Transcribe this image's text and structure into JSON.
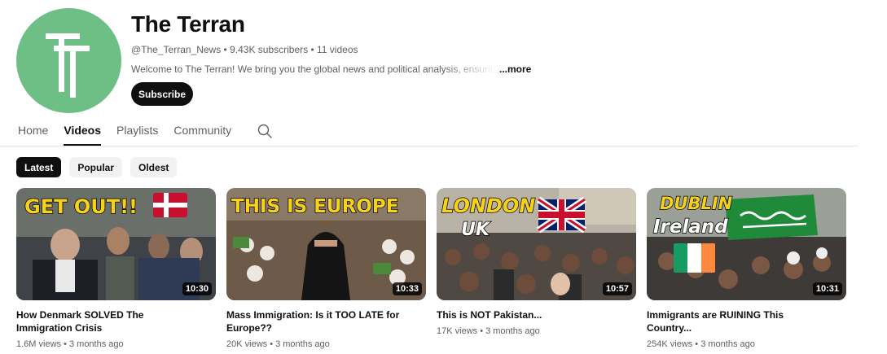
{
  "channel": {
    "avatar_letters": "TT",
    "title": "The Terran",
    "meta": "@The_Terran_News • 9.43K subscribers • 11 videos",
    "description": "Welcome to The Terran! We bring you the global news and political analysis, ensuring you",
    "more_label": "...more",
    "subscribe_label": "Subscribe"
  },
  "tabs": [
    {
      "label": "Home",
      "active": false
    },
    {
      "label": "Videos",
      "active": true
    },
    {
      "label": "Playlists",
      "active": false
    },
    {
      "label": "Community",
      "active": false
    }
  ],
  "search_icon": "search-icon",
  "chips": [
    {
      "label": "Latest",
      "active": true
    },
    {
      "label": "Popular",
      "active": false
    },
    {
      "label": "Oldest",
      "active": false
    }
  ],
  "videos": [
    {
      "title": "How Denmark SOLVED The Immigration Crisis",
      "meta": "1.6M views • 3 months ago",
      "duration": "10:30",
      "thumb_text": [
        "GET OUT!!"
      ],
      "flag": "denmark"
    },
    {
      "title": "Mass Immigration: Is it TOO LATE for Europe??",
      "meta": "20K views • 3 months ago",
      "duration": "10:33",
      "thumb_text": [
        "THIS IS EUROPE"
      ],
      "flag": "none"
    },
    {
      "title": "This is NOT Pakistan...",
      "meta": "17K views • 3 months ago",
      "duration": "10:57",
      "thumb_text": [
        "LONDON",
        "UK"
      ],
      "flag": "uk"
    },
    {
      "title": "Immigrants are RUINING This Country...",
      "meta": "254K views • 3 months ago",
      "duration": "10:31",
      "thumb_text": [
        "DUBLIN",
        "Ireland"
      ],
      "flag": "ireland"
    }
  ],
  "colors": {
    "avatar_bg": "#6dbf86",
    "primary_text": "#0f0f0f",
    "secondary_text": "#606060",
    "chip_bg": "#f2f2f2",
    "thumb_yellow": "#f7d21c"
  }
}
